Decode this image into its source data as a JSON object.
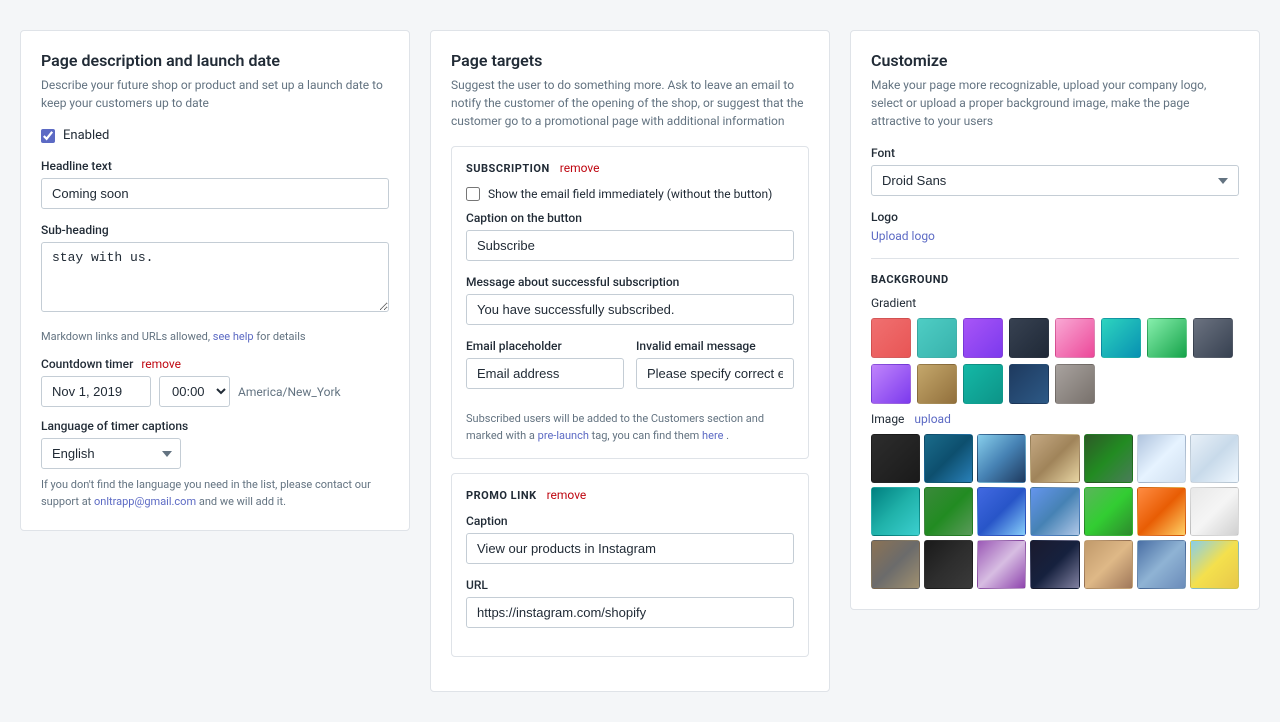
{
  "left": {
    "title": "Page description and launch date",
    "desc": "Describe your future shop or product and set up a launch date to keep your customers up to date",
    "enabled_label": "Enabled",
    "headline_label": "Headline text",
    "headline_value": "Coming soon",
    "subheading_label": "Sub-heading",
    "subheading_value": "stay with us.",
    "markdown_note": "Markdown links and URLs allowed,",
    "see_help": "see help",
    "for_details": "for details",
    "countdown_label": "Countdown timer",
    "remove_countdown": "remove",
    "date_value": "Nov 1, 2019",
    "time_value": "00:00",
    "timezone": "America/New_York",
    "lang_label": "Language of timer captions",
    "lang_value": "English",
    "support_note": "If you don't find the language you need in the list, please contact our support at",
    "support_email": "onltrapp@gmail.com",
    "support_note2": "and we will add it."
  },
  "middle": {
    "title": "Page targets",
    "desc": "Suggest the user to do something more. Ask to leave an email to notify the customer of the opening of the shop, or suggest that the customer go to a promotional page with additional information",
    "subscription": {
      "title": "SUBSCRIPTION",
      "remove": "remove",
      "show_email_label": "Show the email field immediately (without the button)",
      "caption_label": "Caption on the button",
      "caption_value": "Subscribe",
      "success_label": "Message about successful subscription",
      "success_value": "You have successfully subscribed.",
      "email_placeholder_label": "Email placeholder",
      "email_placeholder_value": "Email address",
      "invalid_email_label": "Invalid email message",
      "invalid_email_value": "Please specify correct email a...",
      "subscribed_note": "Subscribed users will be added to the Customers section and marked with a",
      "pre_launch": "pre-launch",
      "note2": "tag, you can find them",
      "here": "here",
      "note3": "."
    },
    "promo": {
      "title": "PROMO LINK",
      "remove": "remove",
      "caption_label": "Caption",
      "caption_value": "View our products in Instagram",
      "url_label": "URL",
      "url_value": "https://instagram.com/shopify"
    }
  },
  "right": {
    "title": "Customize",
    "desc": "Make your page more recognizable, upload your company logo, select or upload a proper background image, make the page attractive to your users",
    "font_label": "Font",
    "font_value": "Droid Sans",
    "logo_label": "Logo",
    "upload_logo": "Upload logo",
    "background_title": "BACKGROUND",
    "gradient_label": "Gradient",
    "image_label": "Image",
    "upload_image": "upload",
    "gradients": [
      {
        "class": "g1",
        "id": "grad-1"
      },
      {
        "class": "g2",
        "id": "grad-2"
      },
      {
        "class": "g3",
        "id": "grad-3"
      },
      {
        "class": "g4",
        "id": "grad-4"
      },
      {
        "class": "g5",
        "id": "grad-5"
      },
      {
        "class": "g6",
        "id": "grad-6"
      },
      {
        "class": "g7",
        "id": "grad-7"
      },
      {
        "class": "g8",
        "id": "grad-8"
      },
      {
        "class": "g9",
        "id": "grad-9"
      },
      {
        "class": "g10",
        "id": "grad-10"
      },
      {
        "class": "g11",
        "id": "grad-11"
      },
      {
        "class": "g12",
        "id": "grad-12"
      },
      {
        "class": "g13",
        "id": "grad-13"
      }
    ],
    "images": [
      {
        "class": "img-dark",
        "id": "img-1"
      },
      {
        "class": "img-blue-cells",
        "id": "img-2"
      },
      {
        "class": "img-ocean",
        "id": "img-3"
      },
      {
        "class": "img-dock",
        "id": "img-4"
      },
      {
        "class": "img-forest",
        "id": "img-5"
      },
      {
        "class": "img-clouds",
        "id": "img-6"
      },
      {
        "class": "img-snow",
        "id": "img-7"
      },
      {
        "class": "img-teal-water",
        "id": "img-8"
      },
      {
        "class": "img-green-plants",
        "id": "img-9"
      },
      {
        "class": "img-blue-abstract",
        "id": "img-10"
      },
      {
        "class": "img-dock2",
        "id": "img-11"
      },
      {
        "class": "img-grass",
        "id": "img-12"
      },
      {
        "class": "img-sunset",
        "id": "img-13"
      },
      {
        "class": "img-white-abstract",
        "id": "img-14"
      },
      {
        "class": "img-road",
        "id": "img-15"
      },
      {
        "class": "img-dark-texture",
        "id": "img-16"
      },
      {
        "class": "img-purple-flower",
        "id": "img-17"
      },
      {
        "class": "img-bokeh",
        "id": "img-18"
      },
      {
        "class": "img-wood",
        "id": "img-19"
      },
      {
        "class": "img-rain",
        "id": "img-20"
      },
      {
        "class": "img-beach",
        "id": "img-21"
      }
    ]
  }
}
